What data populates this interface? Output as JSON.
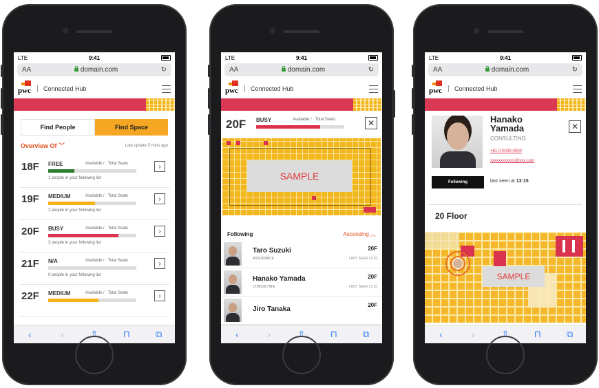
{
  "browser": {
    "carrier": "LTE",
    "time": "9:41",
    "text_size": "AA",
    "domain": "domain.com"
  },
  "app": {
    "logo_text": "pwc",
    "hub_name": "Connected Hub"
  },
  "screen1": {
    "tab_people": "Find People",
    "tab_space": "Find Space",
    "overview_label": "Overview Of",
    "last_update": "Last update 5 mins ago",
    "available_label": "Available /",
    "total_label": "Total Seats",
    "floors": [
      {
        "floor": "18F",
        "status": "FREE",
        "note": "1 people in your following list",
        "fill": 0.3,
        "color": "#2e7d32"
      },
      {
        "floor": "19F",
        "status": "MEDIUM",
        "note": "2 people in your following list",
        "fill": 0.53,
        "color": "#f5b21b"
      },
      {
        "floor": "20F",
        "status": "BUSY",
        "note": "3 people in your following list",
        "fill": 0.8,
        "color": "#d9334f"
      },
      {
        "floor": "21F",
        "status": "N/A",
        "note": "0 people in your following list",
        "fill": 0.0,
        "color": "#dddddd"
      },
      {
        "floor": "22F",
        "status": "MEDIUM",
        "note": "",
        "fill": 0.57,
        "color": "#f5b21b"
      }
    ]
  },
  "screen2": {
    "floor": "20F",
    "status": "BUSY",
    "available_label": "Available /",
    "total_label": "Total Seats",
    "fill": 0.73,
    "sample_label": "SAMPLE",
    "following_label": "Following",
    "sort_label": "Ascending",
    "people": [
      {
        "name": "Taro Suzuki",
        "dept": "ASSURANCE",
        "floor": "20F",
        "seen": "LAST SEEN 13:15"
      },
      {
        "name": "Hanako Yamada",
        "dept": "CONSULTING",
        "floor": "20F",
        "seen": "LAST SEEN 13:15"
      },
      {
        "name": "Jiro Tanaka",
        "dept": "",
        "floor": "20F",
        "seen": ""
      }
    ]
  },
  "screen3": {
    "first_name": "Hanako",
    "last_name": "Yamada",
    "dept": "CONSULTING",
    "phone": "+81 0-0000-0000",
    "email": "xxxxxxxxxxxx@xxx.com",
    "follow_button": "Following",
    "last_seen_prefix": "last seen at",
    "last_seen_time": "13:15",
    "floor_title": "20 Floor",
    "sample_label": "SAMPLE"
  },
  "colors": {
    "brand_red": "#d93954",
    "accent_orange": "#f5a623",
    "link_orange": "#e0501e"
  }
}
